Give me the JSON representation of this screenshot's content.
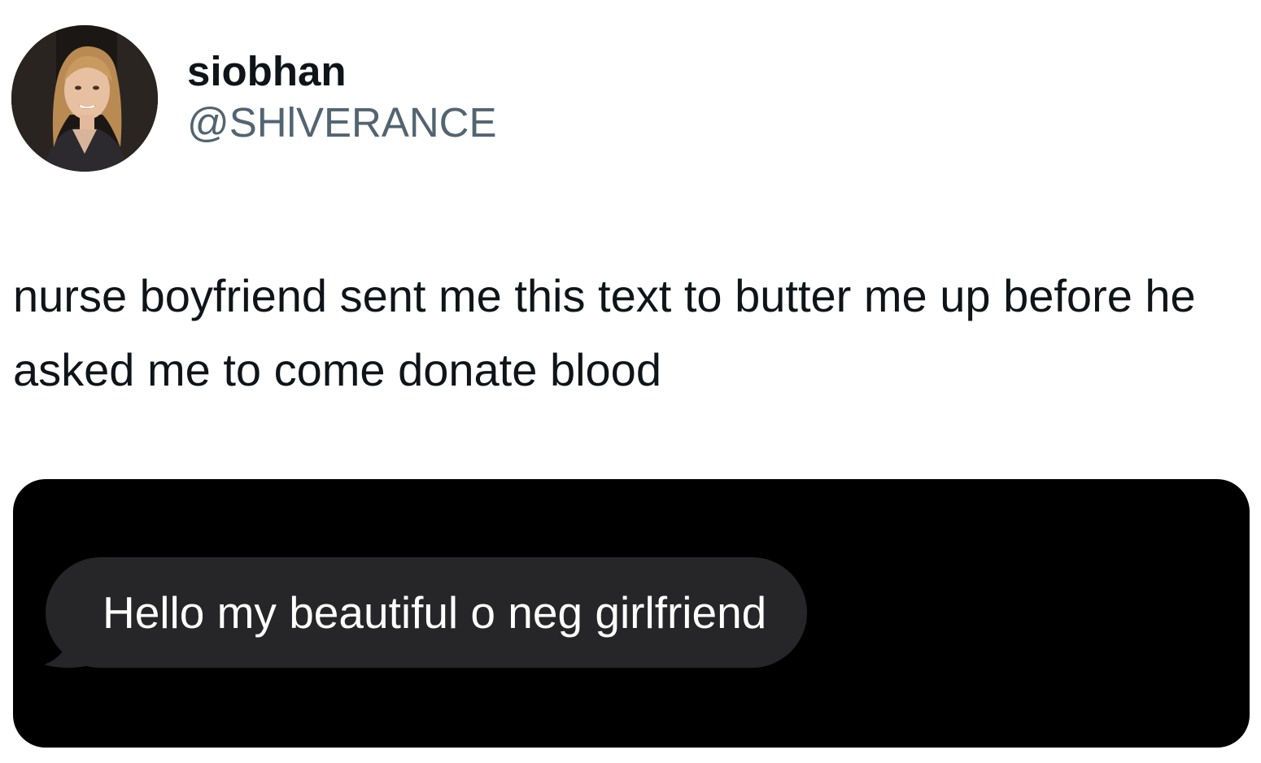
{
  "tweet": {
    "author": {
      "display_name": "siobhan",
      "handle": "@SHlVERANCE"
    },
    "text": "nurse boyfriend sent me this text to butter me up before he asked me to come donate blood",
    "media": {
      "message": "Hello my beautiful o neg girlfriend"
    }
  },
  "colors": {
    "text_primary": "#0f1419",
    "text_secondary": "#536471",
    "media_background": "#000000",
    "bubble_background": "#262628",
    "bubble_text": "#ffffff"
  }
}
